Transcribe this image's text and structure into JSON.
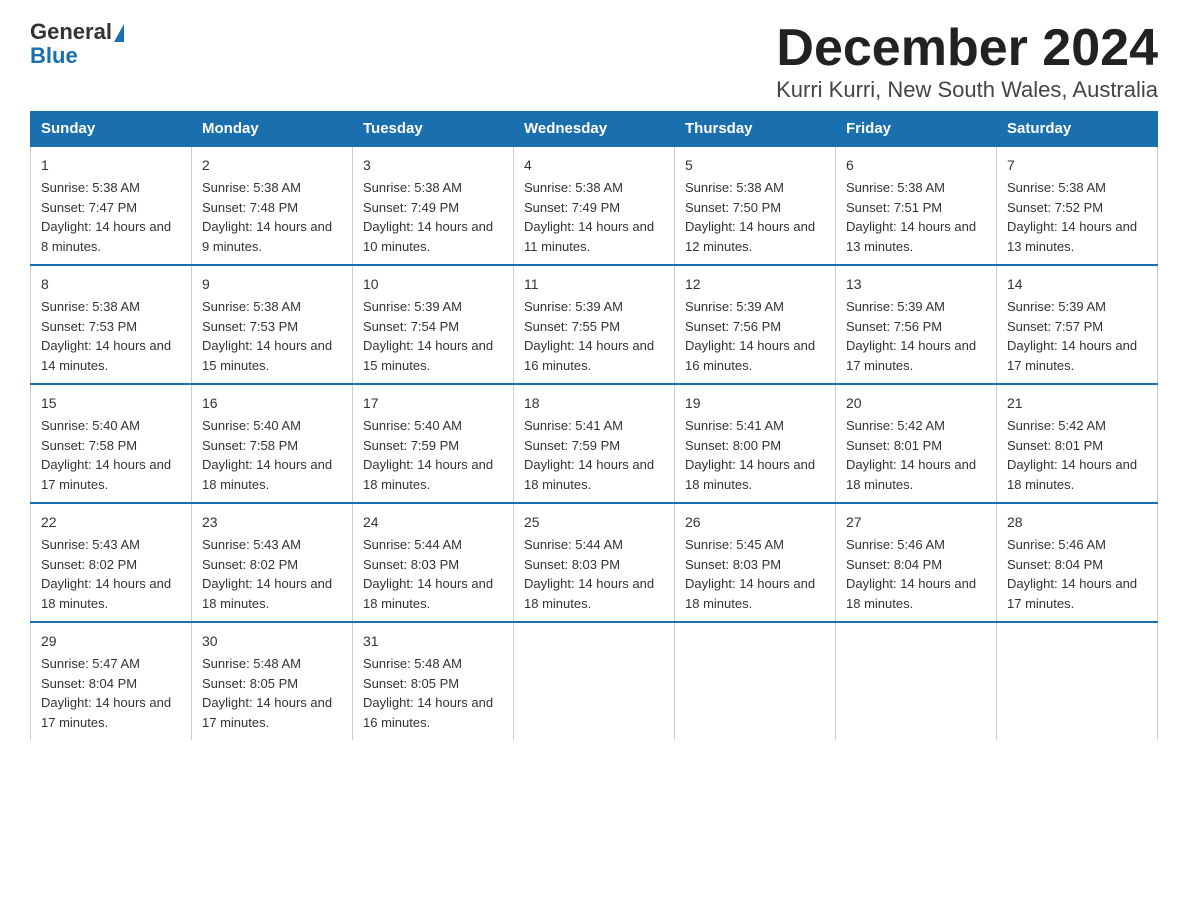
{
  "logo": {
    "general": "General",
    "blue": "Blue"
  },
  "title": "December 2024",
  "subtitle": "Kurri Kurri, New South Wales, Australia",
  "days_of_week": [
    "Sunday",
    "Monday",
    "Tuesday",
    "Wednesday",
    "Thursday",
    "Friday",
    "Saturday"
  ],
  "weeks": [
    [
      {
        "num": "1",
        "sunrise": "5:38 AM",
        "sunset": "7:47 PM",
        "daylight": "14 hours and 8 minutes."
      },
      {
        "num": "2",
        "sunrise": "5:38 AM",
        "sunset": "7:48 PM",
        "daylight": "14 hours and 9 minutes."
      },
      {
        "num": "3",
        "sunrise": "5:38 AM",
        "sunset": "7:49 PM",
        "daylight": "14 hours and 10 minutes."
      },
      {
        "num": "4",
        "sunrise": "5:38 AM",
        "sunset": "7:49 PM",
        "daylight": "14 hours and 11 minutes."
      },
      {
        "num": "5",
        "sunrise": "5:38 AM",
        "sunset": "7:50 PM",
        "daylight": "14 hours and 12 minutes."
      },
      {
        "num": "6",
        "sunrise": "5:38 AM",
        "sunset": "7:51 PM",
        "daylight": "14 hours and 13 minutes."
      },
      {
        "num": "7",
        "sunrise": "5:38 AM",
        "sunset": "7:52 PM",
        "daylight": "14 hours and 13 minutes."
      }
    ],
    [
      {
        "num": "8",
        "sunrise": "5:38 AM",
        "sunset": "7:53 PM",
        "daylight": "14 hours and 14 minutes."
      },
      {
        "num": "9",
        "sunrise": "5:38 AM",
        "sunset": "7:53 PM",
        "daylight": "14 hours and 15 minutes."
      },
      {
        "num": "10",
        "sunrise": "5:39 AM",
        "sunset": "7:54 PM",
        "daylight": "14 hours and 15 minutes."
      },
      {
        "num": "11",
        "sunrise": "5:39 AM",
        "sunset": "7:55 PM",
        "daylight": "14 hours and 16 minutes."
      },
      {
        "num": "12",
        "sunrise": "5:39 AM",
        "sunset": "7:56 PM",
        "daylight": "14 hours and 16 minutes."
      },
      {
        "num": "13",
        "sunrise": "5:39 AM",
        "sunset": "7:56 PM",
        "daylight": "14 hours and 17 minutes."
      },
      {
        "num": "14",
        "sunrise": "5:39 AM",
        "sunset": "7:57 PM",
        "daylight": "14 hours and 17 minutes."
      }
    ],
    [
      {
        "num": "15",
        "sunrise": "5:40 AM",
        "sunset": "7:58 PM",
        "daylight": "14 hours and 17 minutes."
      },
      {
        "num": "16",
        "sunrise": "5:40 AM",
        "sunset": "7:58 PM",
        "daylight": "14 hours and 18 minutes."
      },
      {
        "num": "17",
        "sunrise": "5:40 AM",
        "sunset": "7:59 PM",
        "daylight": "14 hours and 18 minutes."
      },
      {
        "num": "18",
        "sunrise": "5:41 AM",
        "sunset": "7:59 PM",
        "daylight": "14 hours and 18 minutes."
      },
      {
        "num": "19",
        "sunrise": "5:41 AM",
        "sunset": "8:00 PM",
        "daylight": "14 hours and 18 minutes."
      },
      {
        "num": "20",
        "sunrise": "5:42 AM",
        "sunset": "8:01 PM",
        "daylight": "14 hours and 18 minutes."
      },
      {
        "num": "21",
        "sunrise": "5:42 AM",
        "sunset": "8:01 PM",
        "daylight": "14 hours and 18 minutes."
      }
    ],
    [
      {
        "num": "22",
        "sunrise": "5:43 AM",
        "sunset": "8:02 PM",
        "daylight": "14 hours and 18 minutes."
      },
      {
        "num": "23",
        "sunrise": "5:43 AM",
        "sunset": "8:02 PM",
        "daylight": "14 hours and 18 minutes."
      },
      {
        "num": "24",
        "sunrise": "5:44 AM",
        "sunset": "8:03 PM",
        "daylight": "14 hours and 18 minutes."
      },
      {
        "num": "25",
        "sunrise": "5:44 AM",
        "sunset": "8:03 PM",
        "daylight": "14 hours and 18 minutes."
      },
      {
        "num": "26",
        "sunrise": "5:45 AM",
        "sunset": "8:03 PM",
        "daylight": "14 hours and 18 minutes."
      },
      {
        "num": "27",
        "sunrise": "5:46 AM",
        "sunset": "8:04 PM",
        "daylight": "14 hours and 18 minutes."
      },
      {
        "num": "28",
        "sunrise": "5:46 AM",
        "sunset": "8:04 PM",
        "daylight": "14 hours and 17 minutes."
      }
    ],
    [
      {
        "num": "29",
        "sunrise": "5:47 AM",
        "sunset": "8:04 PM",
        "daylight": "14 hours and 17 minutes."
      },
      {
        "num": "30",
        "sunrise": "5:48 AM",
        "sunset": "8:05 PM",
        "daylight": "14 hours and 17 minutes."
      },
      {
        "num": "31",
        "sunrise": "5:48 AM",
        "sunset": "8:05 PM",
        "daylight": "14 hours and 16 minutes."
      },
      null,
      null,
      null,
      null
    ]
  ]
}
